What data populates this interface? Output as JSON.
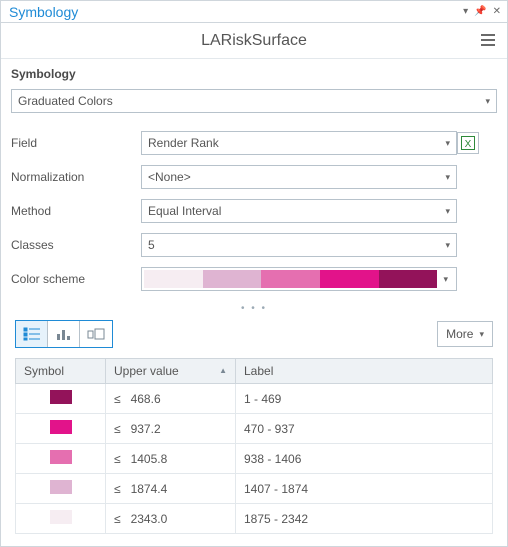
{
  "titlebar": {
    "title": "Symbology"
  },
  "header": {
    "layer_title": "LARiskSurface"
  },
  "section": {
    "symbology_label": "Symbology"
  },
  "primary": {
    "renderer": "Graduated Colors"
  },
  "controls": {
    "field_label": "Field",
    "field_value": "Render Rank",
    "normalization_label": "Normalization",
    "normalization_value": "<None>",
    "method_label": "Method",
    "method_value": "Equal Interval",
    "classes_label": "Classes",
    "classes_value": "5",
    "colorscheme_label": "Color scheme"
  },
  "ramp": {
    "colors": [
      "#f6edf2",
      "#dfb4d2",
      "#e56fb0",
      "#e2138a",
      "#93135a"
    ]
  },
  "toolbar": {
    "more": "More"
  },
  "table": {
    "headers": {
      "symbol": "Symbol",
      "upper": "Upper value",
      "label": "Label"
    },
    "rows": [
      {
        "color": "#93135a",
        "upper": "≤   468.6",
        "label": "1 - 469"
      },
      {
        "color": "#e2138a",
        "upper": "≤   937.2",
        "label": "470 - 937"
      },
      {
        "color": "#e56fb0",
        "upper": "≤   1405.8",
        "label": "938 - 1406"
      },
      {
        "color": "#dfb4d2",
        "upper": "≤   1874.4",
        "label": "1407 - 1874"
      },
      {
        "color": "#f6edf2",
        "upper": "≤   2343.0",
        "label": "1875 - 2342"
      }
    ]
  }
}
